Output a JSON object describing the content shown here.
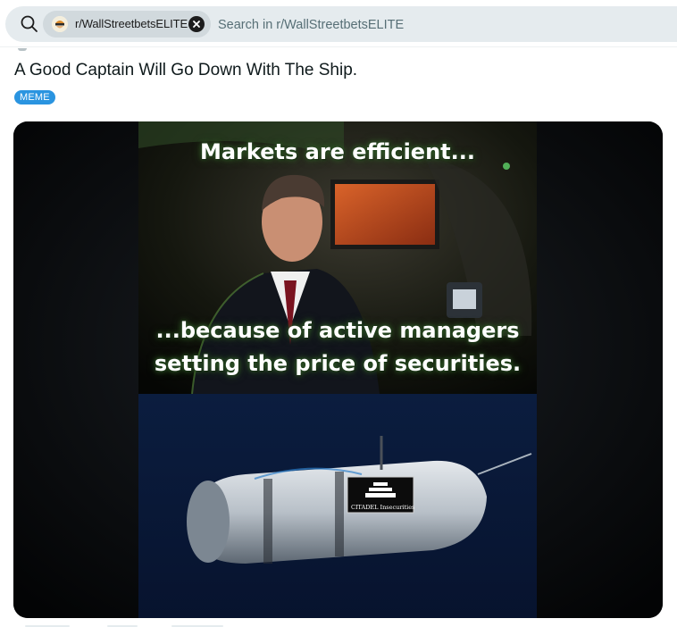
{
  "search": {
    "community_chip": "r/WallStreetbetsELITE",
    "placeholder": "Search in r/WallStreetbetsELITE"
  },
  "post": {
    "title": "A Good Captain Will Go Down With The Ship.",
    "flair": "MEME",
    "flair_color": "#2a94e0"
  },
  "meme": {
    "caption_top": "Markets are efficient...",
    "caption_bottom_line1": "...because of active managers",
    "caption_bottom_line2": "setting the price of securities.",
    "submarine_label": "CITADEL Insecurities"
  },
  "icons": [
    "search-icon",
    "community-avatar-icon",
    "clear-chip-icon"
  ]
}
